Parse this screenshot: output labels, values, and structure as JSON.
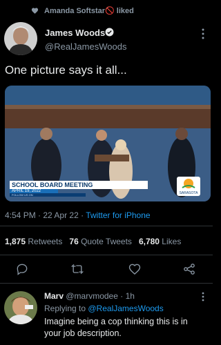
{
  "liked_banner": {
    "text": "Amanda Softstar🚫 liked"
  },
  "author": {
    "name": "James Woods",
    "handle": "@RealJamesWoods"
  },
  "tweet": {
    "text": "One picture says it all..."
  },
  "media": {
    "chyron_title": "SCHOOL BOARD MEETING",
    "chyron_date": "APRIL 19, 2022",
    "chyron_follow": "FOLLOW US ON",
    "station_logo": "SARASOTA"
  },
  "meta": {
    "time": "4:54 PM",
    "sep1": " · ",
    "date": "22 Apr 22",
    "sep2": " · ",
    "source": "Twitter for iPhone"
  },
  "stats": {
    "retweets_count": "1,875",
    "retweets_label": " Retweets",
    "quotes_count": "76",
    "quotes_label": " Quote Tweets",
    "likes_count": "6,780",
    "likes_label": " Likes"
  },
  "actions": [
    "reply-icon",
    "retweet-icon",
    "like-icon",
    "share-icon"
  ],
  "reply": {
    "name": "Marv",
    "handle": "@marvmodee",
    "time_sep": " · ",
    "time": "1h",
    "replying_label": "Replying to ",
    "mention": "@RealJamesWoods",
    "text": "Imagine being a cop thinking this is in your job description."
  },
  "colors": {
    "accent": "#1d9bf0",
    "secondary_text": "#8b98a5",
    "divider": "#2f3336"
  }
}
